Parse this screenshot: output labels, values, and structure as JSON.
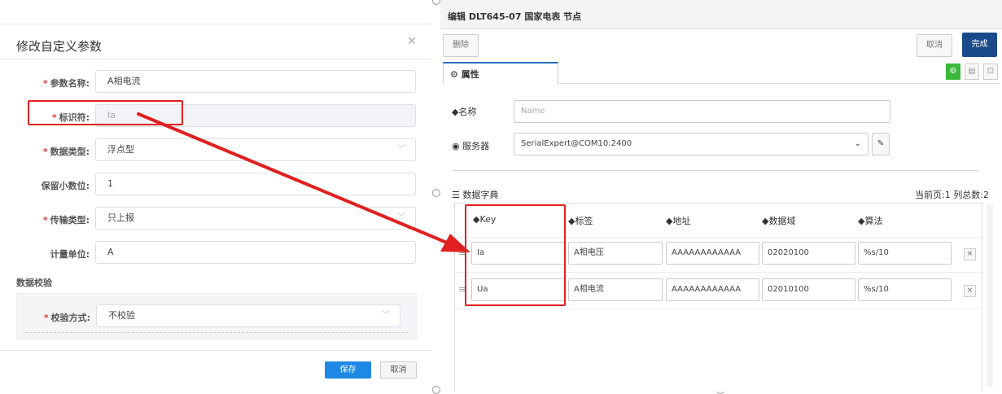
{
  "dialog": {
    "title": "修改自定义参数",
    "close_icon": "close-icon",
    "fields": [
      {
        "label": "参数名称:",
        "required": true,
        "value": "A相电流",
        "type": "text"
      },
      {
        "label": "标识符:",
        "required": true,
        "value": "Ia",
        "type": "disabled"
      },
      {
        "label": "数据类型:",
        "required": true,
        "value": "浮点型",
        "type": "select"
      },
      {
        "label": "保留小数位:",
        "required": false,
        "value": "1",
        "type": "text"
      },
      {
        "label": "传输类型:",
        "required": true,
        "value": "只上报",
        "type": "select"
      },
      {
        "label": "计量单位:",
        "required": false,
        "value": "A",
        "type": "text"
      }
    ],
    "section_title": "数据校验",
    "verify": {
      "label": "校验方式:",
      "required": true,
      "value": "不校验"
    },
    "save_label": "保存",
    "cancel_label": "取消",
    "star": "*"
  },
  "editor": {
    "title": "编辑 DLT645-07 国家电表 节点",
    "delete_label": "删除",
    "cancel_label": "取消",
    "done_label": "完成",
    "tab_label": "属性",
    "name_label": "名称",
    "name_placeholder": "Name",
    "server_label": "服务器",
    "server_value": "SerialExpert@COM10:2400",
    "dict_title": "数据字典",
    "page_info": "当前页:1  列总数:2",
    "columns": [
      "Key",
      "标签",
      "地址",
      "数据域",
      "算法"
    ],
    "rows": [
      {
        "key": "Ia",
        "tag": "A相电压",
        "address": "AAAAAAAAAAAA",
        "domain": "02020100",
        "algo": "%s/10",
        "remove": "×"
      },
      {
        "key": "Ua",
        "tag": "A相电流",
        "address": "AAAAAAAAAAAA",
        "domain": "02010100",
        "algo": "%s/10",
        "remove": "×"
      }
    ]
  },
  "colors": {
    "accent_blue": "#1e88e5",
    "done_dark_blue": "#1a4a8a",
    "annotation_red": "#e02020",
    "gear_green": "#3cb93c"
  }
}
